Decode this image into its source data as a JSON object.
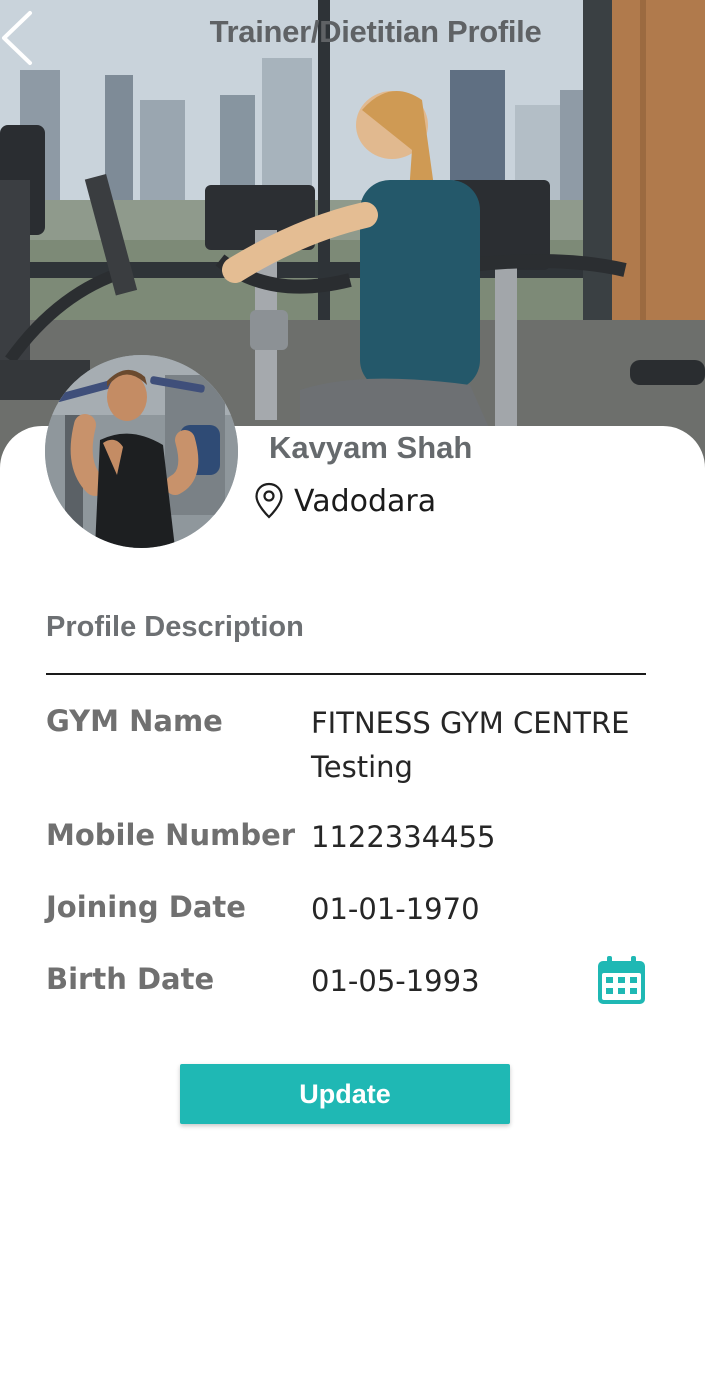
{
  "header": {
    "title": "Trainer/Dietitian Profile",
    "back_icon": "chevron-left-icon"
  },
  "profile": {
    "name": "Kavyam Shah",
    "location": "Vadodara",
    "location_icon": "location-pin-icon"
  },
  "details": {
    "section_title": "Profile Description",
    "fields": [
      {
        "label": "GYM Name",
        "value": "FITNESS GYM CENTRE Testing"
      },
      {
        "label": "Mobile Number",
        "value": "1122334455"
      },
      {
        "label": "Joining Date",
        "value": "01-01-1970"
      },
      {
        "label": "Birth Date",
        "value": "01-05-1993"
      }
    ],
    "calendar_icon": "calendar-icon"
  },
  "actions": {
    "update_label": "Update"
  },
  "colors": {
    "accent": "#1fb8b4",
    "label_gray": "#707070",
    "value_dark": "#262626"
  }
}
